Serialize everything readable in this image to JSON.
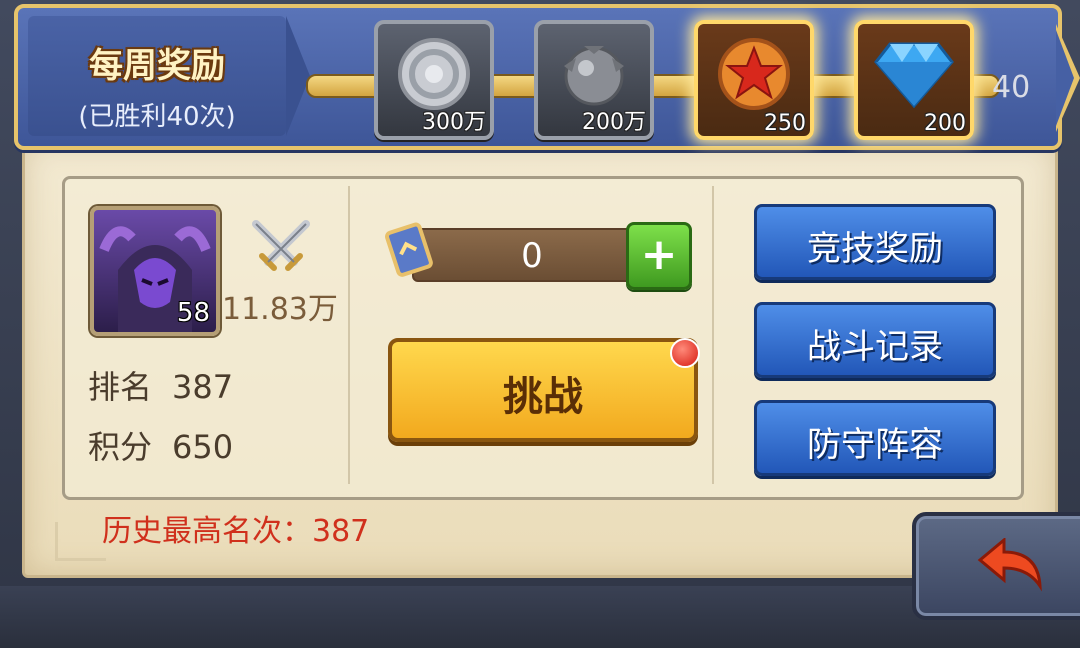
{
  "weekly_reward": {
    "title": "每周奖励",
    "subtitle": "(已胜利40次)",
    "progress_count": "40",
    "rewards": [
      {
        "amount": "300万",
        "icon": "silver-coin-icon",
        "claimable": false
      },
      {
        "amount": "200万",
        "icon": "grey-orb-icon",
        "claimable": false
      },
      {
        "amount": "250",
        "icon": "red-star-medal-icon",
        "claimable": true
      },
      {
        "amount": "200",
        "icon": "blue-diamond-icon",
        "claimable": true
      }
    ]
  },
  "player": {
    "level": "58",
    "power": "11.83万",
    "rank_label": "排名",
    "rank_value": "387",
    "score_label": "积分",
    "score_value": "650"
  },
  "challenge": {
    "tickets": "0",
    "button_label": "挑战"
  },
  "side_buttons": {
    "arena_reward": "竞技奖励",
    "battle_log": "战斗记录",
    "defense_lineup": "防守阵容"
  },
  "history_best": "历史最高名次：387",
  "colors": {
    "accent_gold": "#f2a91e",
    "button_blue": "#2257b8",
    "history_red": "#d0301c",
    "add_green": "#3f9a20"
  }
}
